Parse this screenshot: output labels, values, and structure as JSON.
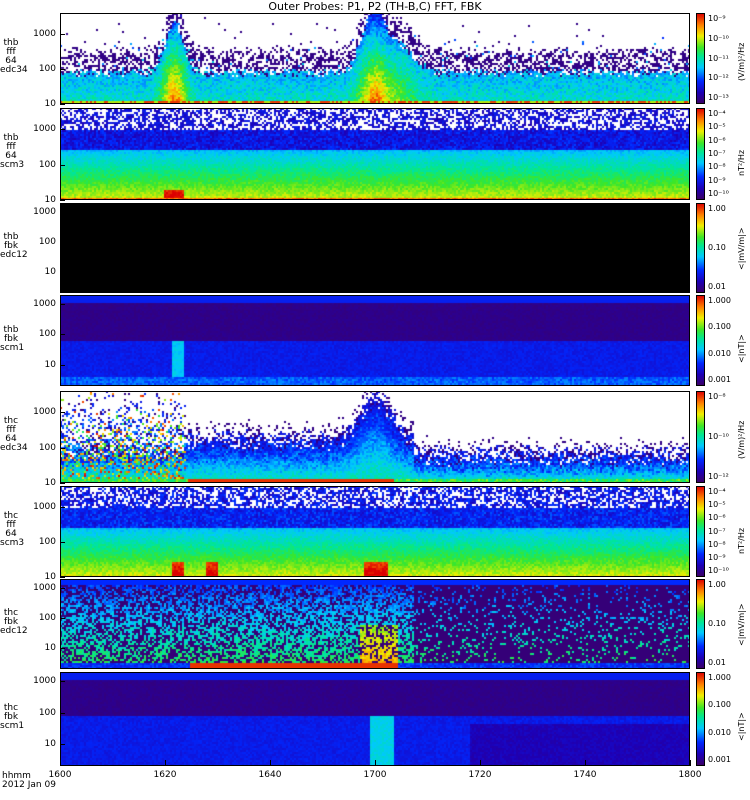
{
  "title": "Outer Probes: P1, P2 (TH-B,C) FFT, FBK",
  "time_axis": {
    "label_format": "hhmm",
    "date": "2012 Jan 09",
    "ticks": [
      "1600",
      "1620",
      "1640",
      "1700",
      "1720",
      "1740",
      "1800"
    ]
  },
  "colors": {
    "background": "#ffffff",
    "fill_black": "#000000",
    "colormap": "rainbow (violet-blue-cyan-green-yellow-red)"
  },
  "chart_data": [
    {
      "type": "heatmap",
      "probe": "thb",
      "instrument": "fft",
      "mode": "64",
      "quantity": "edc34",
      "ylabel": [
        "thb",
        "fff",
        "64",
        "edc34"
      ],
      "yscale": "log",
      "ylim": [
        10,
        4000
      ],
      "ytick_labels": [
        "10",
        "100",
        "1000"
      ],
      "cbar_ticks": [
        "10⁻⁹",
        "10⁻¹⁰",
        "10⁻¹¹",
        "10⁻¹²",
        "10⁻¹³"
      ],
      "cbar_unit": "(V/m)²/Hz",
      "x": [
        1600,
        1800
      ],
      "features": [
        {
          "x_start": 1633,
          "x_end": 1640,
          "level": "high"
        },
        {
          "x_start": 1655,
          "x_end": 1707,
          "level": "very high"
        }
      ]
    },
    {
      "type": "heatmap",
      "probe": "thb",
      "instrument": "fff",
      "mode": "64",
      "quantity": "scm3",
      "ylabel": [
        "thb",
        "fff",
        "64",
        "scm3"
      ],
      "yscale": "log",
      "ylim": [
        10,
        4000
      ],
      "ytick_labels": [
        "10",
        "100",
        "1000"
      ],
      "cbar_ticks": [
        "10⁻⁴",
        "10⁻⁵",
        "10⁻⁶",
        "10⁻⁷",
        "10⁻⁸",
        "10⁻⁹",
        "10⁻¹⁰"
      ],
      "cbar_unit": "nT²/Hz",
      "x": [
        1600,
        1800
      ]
    },
    {
      "type": "heatmap",
      "probe": "thb",
      "instrument": "fbk",
      "quantity": "edc12",
      "ylabel": [
        "thb",
        "fbk",
        "edc12"
      ],
      "yscale": "log",
      "ylim": [
        2,
        2000
      ],
      "ytick_labels": [
        "10",
        "100",
        "1000"
      ],
      "cbar_ticks": [
        "1.00",
        "0.10",
        "0.01"
      ],
      "cbar_unit": "<|mV/m|>",
      "x": [
        1600,
        1800
      ]
    },
    {
      "type": "heatmap",
      "probe": "thb",
      "instrument": "fbk",
      "quantity": "scm1",
      "ylabel": [
        "thb",
        "fbk",
        "scm1"
      ],
      "yscale": "log",
      "ylim": [
        2,
        2000
      ],
      "ytick_labels": [
        "10",
        "100",
        "1000"
      ],
      "cbar_ticks": [
        "1.000",
        "0.100",
        "0.010",
        "0.001"
      ],
      "cbar_unit": "<|nT|>",
      "x": [
        1600,
        1800
      ]
    },
    {
      "type": "heatmap",
      "probe": "thc",
      "instrument": "fff",
      "mode": "64",
      "quantity": "edc34",
      "ylabel": [
        "thc",
        "fff",
        "64",
        "edc34"
      ],
      "yscale": "log",
      "ylim": [
        10,
        4000
      ],
      "ytick_labels": [
        "10",
        "100",
        "1000"
      ],
      "cbar_ticks": [
        "10⁻⁸",
        "10⁻¹⁰",
        "10⁻¹²"
      ],
      "cbar_unit": "(V/m)²/Hz",
      "x": [
        1600,
        1800
      ]
    },
    {
      "type": "heatmap",
      "probe": "thc",
      "instrument": "fff",
      "mode": "64",
      "quantity": "scm3",
      "ylabel": [
        "thc",
        "fff",
        "64",
        "scm3"
      ],
      "yscale": "log",
      "ylim": [
        10,
        4000
      ],
      "ytick_labels": [
        "10",
        "100",
        "1000"
      ],
      "cbar_ticks": [
        "10⁻⁴",
        "10⁻⁵",
        "10⁻⁶",
        "10⁻⁷",
        "10⁻⁸",
        "10⁻⁹",
        "10⁻¹⁰"
      ],
      "cbar_unit": "nT²/Hz",
      "x": [
        1600,
        1800
      ]
    },
    {
      "type": "heatmap",
      "probe": "thc",
      "instrument": "fbk",
      "quantity": "edc12",
      "ylabel": [
        "thc",
        "fbk",
        "edc12"
      ],
      "yscale": "log",
      "ylim": [
        2,
        2000
      ],
      "ytick_labels": [
        "10",
        "100",
        "1000"
      ],
      "cbar_ticks": [
        "1.00",
        "0.10",
        "0.01"
      ],
      "cbar_unit": "<|mV/m|>",
      "x": [
        1600,
        1800
      ]
    },
    {
      "type": "heatmap",
      "probe": "thc",
      "instrument": "fbk",
      "quantity": "scm1",
      "ylabel": [
        "thc",
        "fbk",
        "scm1"
      ],
      "yscale": "log",
      "ylim": [
        2,
        2000
      ],
      "ytick_labels": [
        "10",
        "100",
        "1000"
      ],
      "cbar_ticks": [
        "1.000",
        "0.100",
        "0.010",
        "0.001"
      ],
      "cbar_unit": "<|nT|>",
      "x": [
        1600,
        1800
      ]
    }
  ]
}
